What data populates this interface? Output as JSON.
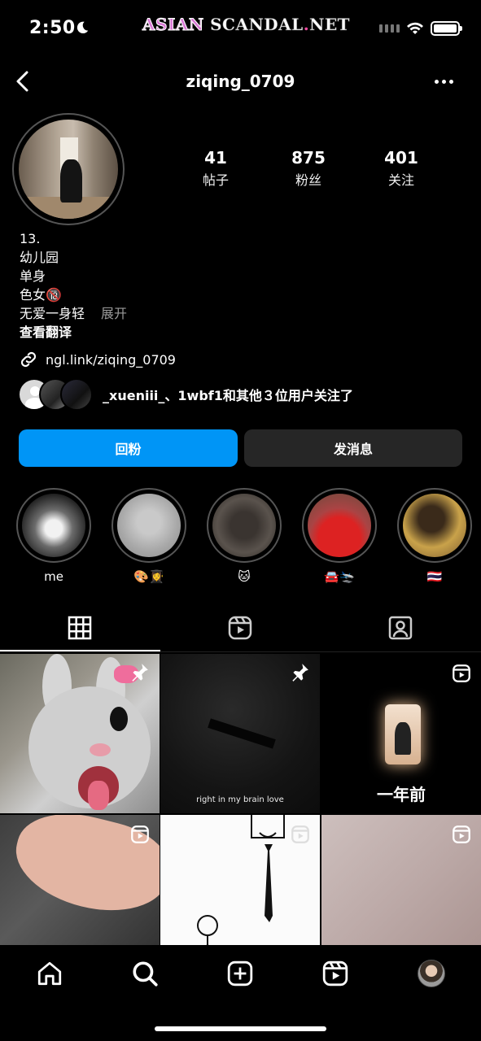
{
  "status_bar": {
    "time": "2:50",
    "watermark_part1": "ASIAN",
    "watermark_part2": "SCANDAL",
    "watermark_dot": ".",
    "watermark_part3": "NET"
  },
  "nav": {
    "username": "ziqing_0709"
  },
  "profile": {
    "stats": [
      {
        "value": "41",
        "label": "帖子"
      },
      {
        "value": "875",
        "label": "粉丝"
      },
      {
        "value": "401",
        "label": "关注"
      }
    ],
    "bio": {
      "line1": "13.",
      "line2": "幼儿园",
      "line3": "单身",
      "line4": "色女🔞",
      "line5": "无爱一身轻",
      "more": "展开",
      "translate": "查看翻译"
    },
    "link": "ngl.link/ziqing_0709",
    "followed_by": "_xueniii_、1wbf1和其他３位用户关注了"
  },
  "buttons": {
    "follow_back": "回粉",
    "message": "发消息"
  },
  "highlights": [
    {
      "label": "me"
    },
    {
      "label": "🎨👩‍🎓"
    },
    {
      "label": "🐱"
    },
    {
      "label": "🚘🛬"
    },
    {
      "label": "🇹🇭"
    }
  ],
  "tabs": [
    "grid-icon",
    "reels-icon",
    "tagged-icon"
  ],
  "grid": {
    "post2_caption": "right in my brain love",
    "post3_caption": "一年前"
  },
  "bottom_nav": [
    "home-icon",
    "search-icon",
    "create-icon",
    "reels-icon",
    "profile-avatar"
  ]
}
